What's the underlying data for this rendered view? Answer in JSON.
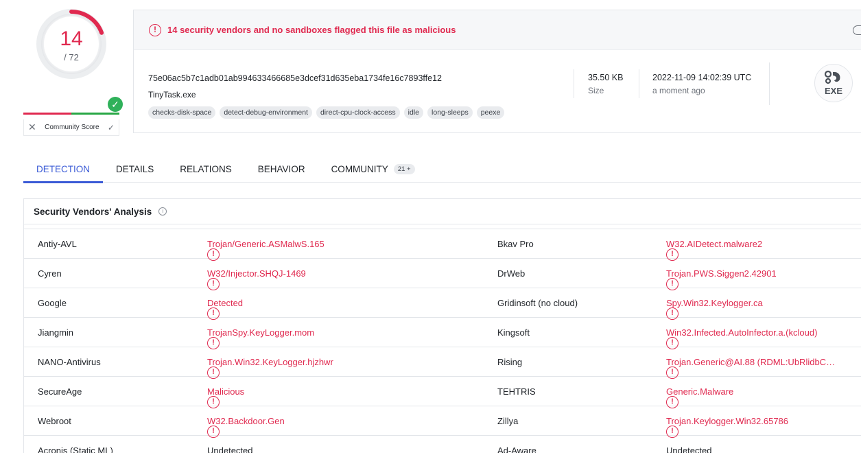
{
  "score": {
    "detected": "14",
    "total": "/ 72",
    "detection_ratio": 0.194,
    "danger_color": "#e0294f"
  },
  "community": {
    "label": "Community Score",
    "reject_icon": "x-icon",
    "approve_icon": "check-icon"
  },
  "alert": {
    "text": "14 security vendors and no sandboxes flagged this file as malicious"
  },
  "file": {
    "hash": "75e06ac5b7c1adb01ab994633466685e3dcef31d635eba1734fe16c7893ffe12",
    "name": "TinyTask.exe",
    "tags": [
      "checks-disk-space",
      "detect-debug-environment",
      "direct-cpu-clock-access",
      "idle",
      "long-sleeps",
      "peexe"
    ],
    "size_value": "35.50 KB",
    "size_label": "Size",
    "date_value": "2022-11-09 14:02:39 UTC",
    "date_label": "a moment ago",
    "type_badge": "EXE"
  },
  "tabs": [
    {
      "label": "DETECTION",
      "active": true
    },
    {
      "label": "DETAILS"
    },
    {
      "label": "RELATIONS"
    },
    {
      "label": "BEHAVIOR"
    },
    {
      "label": "COMMUNITY",
      "badge": "21 +"
    }
  ],
  "analysis": {
    "title": "Security Vendors' Analysis",
    "info_icon": "info-icon",
    "rows": [
      {
        "v1": "Antiy-AVL",
        "r1": "Trojan/Generic.ASMalwS.165",
        "s1": "mal",
        "v2": "Bkav Pro",
        "r2": "W32.AIDetect.malware2",
        "s2": "mal"
      },
      {
        "v1": "Cyren",
        "r1": "W32/Injector.SHQJ-1469",
        "s1": "mal",
        "v2": "DrWeb",
        "r2": "Trojan.PWS.Siggen2.42901",
        "s2": "mal"
      },
      {
        "v1": "Google",
        "r1": "Detected",
        "s1": "mal",
        "v2": "Gridinsoft (no cloud)",
        "r2": "Spy.Win32.Keylogger.ca",
        "s2": "mal"
      },
      {
        "v1": "Jiangmin",
        "r1": "TrojanSpy.KeyLogger.mom",
        "s1": "mal",
        "v2": "Kingsoft",
        "r2": "Win32.Infected.AutoInfector.a.(kcloud)",
        "s2": "mal"
      },
      {
        "v1": "NANO-Antivirus",
        "r1": "Trojan.Win32.KeyLogger.hjzhwr",
        "s1": "mal",
        "v2": "Rising",
        "r2": "Trojan.Generic@AI.88 (RDML:UbRlidbC…",
        "s2": "mal"
      },
      {
        "v1": "SecureAge",
        "r1": "Malicious",
        "s1": "mal",
        "v2": "TEHTRIS",
        "r2": "Generic.Malware",
        "s2": "mal"
      },
      {
        "v1": "Webroot",
        "r1": "W32.Backdoor.Gen",
        "s1": "mal",
        "v2": "Zillya",
        "r2": "Trojan.Keylogger.Win32.65786",
        "s2": "mal"
      },
      {
        "v1": "Acronis (Static ML)",
        "r1": "Undetected",
        "s1": "clean",
        "v2": "Ad-Aware",
        "r2": "Undetected",
        "s2": "clean"
      }
    ]
  }
}
